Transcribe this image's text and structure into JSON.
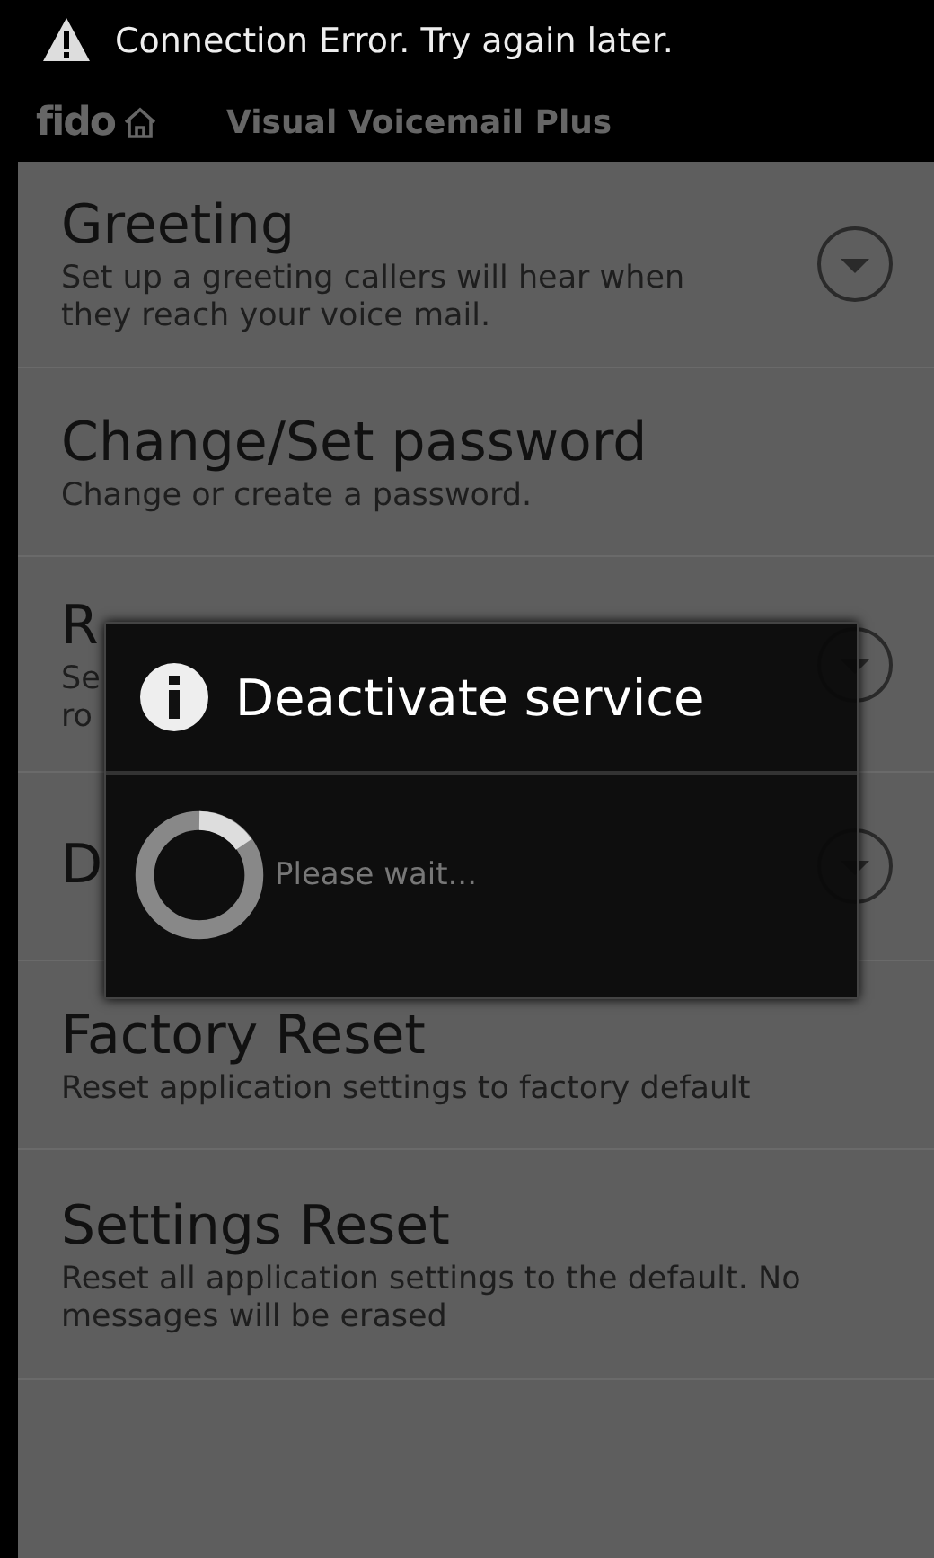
{
  "notification": {
    "text": "Connection Error. Try again later."
  },
  "title_bar": {
    "logo": "fido",
    "title": "Visual Voicemail Plus"
  },
  "settings": [
    {
      "title": "Greeting",
      "description": "Set up a greeting callers will hear when they reach your voice mail.",
      "expandable": true
    },
    {
      "title": "Change/Set password",
      "description": "Change or create a password.",
      "expandable": false
    },
    {
      "title": "R",
      "description": "Se",
      "description_end": "ro",
      "expandable": true
    },
    {
      "title": "D",
      "expandable": true
    },
    {
      "title": "Factory Reset",
      "description": "Reset application settings to factory default",
      "expandable": false
    },
    {
      "title": "Settings Reset",
      "description": "Reset all application settings to the default. No messages will be erased",
      "expandable": false
    }
  ],
  "dialog": {
    "title": "Deactivate service",
    "message": "Please wait..."
  }
}
